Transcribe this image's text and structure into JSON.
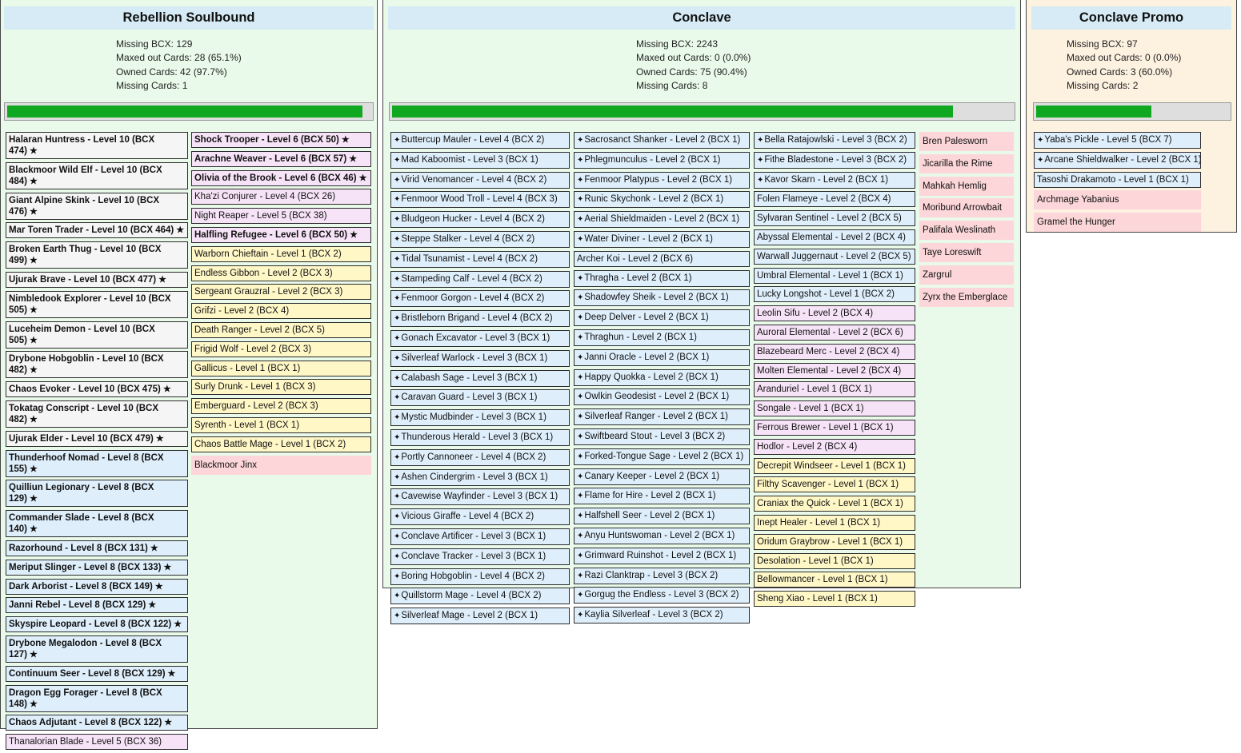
{
  "colors": {
    "panel_green": "#eafaea",
    "panel_orange": "#fdf1e0",
    "title_blue": "#d6ebf5",
    "progress_green": "#0fa820",
    "card_gray": "#f5f5f5",
    "card_blue": "#deeefb",
    "card_yellow": "#fff7c6",
    "card_pink": "#f7e3f7",
    "card_red": "#fcd6d8"
  },
  "panels": [
    {
      "title": "Rebellion Soulbound",
      "stats": [
        "Missing BCX: 129",
        "Maxed out Cards: 28 (65.1%)",
        "Owned Cards: 42 (97.7%)",
        "Missing Cards: 1"
      ],
      "progress": 0.977,
      "columns": [
        [
          {
            "label": "Halaran Huntress - Level 10 (BCX 474)",
            "style": "gray",
            "bold": true,
            "star": true
          },
          {
            "label": "Blackmoor Wild Elf - Level 10 (BCX 484)",
            "style": "gray",
            "bold": true,
            "star": true
          },
          {
            "label": "Giant Alpine Skink - Level 10 (BCX 476)",
            "style": "gray",
            "bold": true,
            "star": true
          },
          {
            "label": "Mar Toren Trader - Level 10 (BCX 464)",
            "style": "gray",
            "bold": true,
            "star": true
          },
          {
            "label": "Broken Earth Thug - Level 10 (BCX 499)",
            "style": "gray",
            "bold": true,
            "star": true
          },
          {
            "label": "Ujurak Brave - Level 10 (BCX 477)",
            "style": "gray",
            "bold": true,
            "star": true
          },
          {
            "label": "Nimbledook Explorer - Level 10 (BCX 505)",
            "style": "gray",
            "bold": true,
            "star": true
          },
          {
            "label": "Luceheim Demon - Level 10 (BCX 505)",
            "style": "gray",
            "bold": true,
            "star": true
          },
          {
            "label": "Drybone Hobgoblin - Level 10 (BCX 482)",
            "style": "gray",
            "bold": true,
            "star": true
          },
          {
            "label": "Chaos Evoker - Level 10 (BCX 475)",
            "style": "gray",
            "bold": true,
            "star": true
          },
          {
            "label": "Tokatag Conscript - Level 10 (BCX 482)",
            "style": "gray",
            "bold": true,
            "star": true
          },
          {
            "label": "Ujurak Elder - Level 10 (BCX 479)",
            "style": "gray",
            "bold": true,
            "star": true
          },
          {
            "label": "Thunderhoof Nomad - Level 8 (BCX 155)",
            "style": "blue",
            "bold": true,
            "star": true
          },
          {
            "label": "Quilliun Legionary - Level 8 (BCX 129)",
            "style": "blue",
            "bold": true,
            "star": true
          },
          {
            "label": "Commander Slade - Level 8 (BCX 140)",
            "style": "blue",
            "bold": true,
            "star": true
          },
          {
            "label": "Razorhound - Level 8 (BCX 131)",
            "style": "blue",
            "bold": true,
            "star": true
          },
          {
            "label": "Meriput Slinger - Level 8 (BCX 133)",
            "style": "blue",
            "bold": true,
            "star": true
          },
          {
            "label": "Dark Arborist - Level 8 (BCX 149)",
            "style": "blue",
            "bold": true,
            "star": true
          },
          {
            "label": "Janni Rebel - Level 8 (BCX 129)",
            "style": "blue",
            "bold": true,
            "star": true
          },
          {
            "label": "Skyspire Leopard - Level 8 (BCX 122)",
            "style": "blue",
            "bold": true,
            "star": true
          },
          {
            "label": "Drybone Megalodon - Level 8 (BCX 127)",
            "style": "blue",
            "bold": true,
            "star": true
          },
          {
            "label": "Continuum Seer - Level 8 (BCX 129)",
            "style": "blue",
            "bold": true,
            "star": true
          },
          {
            "label": "Dragon Egg Forager - Level 8 (BCX 148)",
            "style": "blue",
            "bold": true,
            "star": true
          },
          {
            "label": "Chaos Adjutant - Level 8 (BCX 122)",
            "style": "blue",
            "bold": true,
            "star": true
          },
          {
            "label": "Thanalorian Blade - Level 5 (BCX 36)",
            "style": "pink"
          }
        ],
        [
          {
            "label": "Shock Trooper - Level 6 (BCX 50)",
            "style": "pink",
            "bold": true,
            "star": true
          },
          {
            "label": "Arachne Weaver - Level 6 (BCX 57)",
            "style": "pink",
            "bold": true,
            "star": true
          },
          {
            "label": "Olivia of the Brook - Level 6 (BCX 46)",
            "style": "pink",
            "bold": true,
            "star": true
          },
          {
            "label": "Kha'zi Conjurer - Level 4 (BCX 26)",
            "style": "pink"
          },
          {
            "label": "Night Reaper - Level 5 (BCX 38)",
            "style": "pink"
          },
          {
            "label": "Halfling Refugee - Level 6 (BCX 50)",
            "style": "pink",
            "bold": true,
            "star": true
          },
          {
            "label": "Warborn Chieftain - Level 1 (BCX 2)",
            "style": "yellow"
          },
          {
            "label": "Endless Gibbon - Level 2 (BCX 3)",
            "style": "yellow"
          },
          {
            "label": "Sergeant Grauzral - Level 2 (BCX 3)",
            "style": "yellow"
          },
          {
            "label": "Grifzi - Level 2 (BCX 4)",
            "style": "yellow"
          },
          {
            "label": "Death Ranger - Level 2 (BCX 5)",
            "style": "yellow"
          },
          {
            "label": "Frigid Wolf - Level 2 (BCX 3)",
            "style": "yellow"
          },
          {
            "label": "Gallicus - Level 1 (BCX 1)",
            "style": "yellow"
          },
          {
            "label": "Surly Drunk - Level 1 (BCX 3)",
            "style": "yellow"
          },
          {
            "label": "Emberguard - Level 2 (BCX 3)",
            "style": "yellow"
          },
          {
            "label": "Syrenth - Level 1 (BCX 1)",
            "style": "yellow"
          },
          {
            "label": "Chaos Battle Mage - Level 1 (BCX 2)",
            "style": "yellow"
          },
          {
            "label": "Blackmoor Jinx",
            "style": "red"
          }
        ]
      ]
    },
    {
      "title": "Conclave",
      "stats": [
        "Missing BCX: 2243",
        "Maxed out Cards: 0 (0.0%)",
        "Owned Cards: 75 (90.4%)",
        "Missing Cards: 8"
      ],
      "progress": 0.904,
      "columns": [
        [
          {
            "label": "Buttercup Mauler - Level 4 (BCX 2)",
            "style": "blue",
            "bolt": true
          },
          {
            "label": "Mad Kaboomist - Level 3 (BCX 1)",
            "style": "blue",
            "bolt": true
          },
          {
            "label": "Virid Venomancer - Level 4 (BCX 2)",
            "style": "blue",
            "bolt": true
          },
          {
            "label": "Fenmoor Wood Troll - Level 4 (BCX 3)",
            "style": "blue",
            "bolt": true
          },
          {
            "label": "Bludgeon Hucker - Level 4 (BCX 2)",
            "style": "blue",
            "bolt": true
          },
          {
            "label": "Steppe Stalker - Level 4 (BCX 2)",
            "style": "blue",
            "bolt": true
          },
          {
            "label": "Tidal Tsunamist - Level 4 (BCX 2)",
            "style": "blue",
            "bolt": true
          },
          {
            "label": "Stampeding Calf - Level 4 (BCX 2)",
            "style": "blue",
            "bolt": true
          },
          {
            "label": "Fenmoor Gorgon - Level 4 (BCX 2)",
            "style": "blue",
            "bolt": true
          },
          {
            "label": "Bristleborn Brigand - Level 4 (BCX 2)",
            "style": "blue",
            "bolt": true
          },
          {
            "label": "Gonach Excavator - Level 3 (BCX 1)",
            "style": "blue",
            "bolt": true
          },
          {
            "label": "Silverleaf Warlock - Level 3 (BCX 1)",
            "style": "blue",
            "bolt": true
          },
          {
            "label": "Calabash Sage - Level 3 (BCX 1)",
            "style": "blue",
            "bolt": true
          },
          {
            "label": "Caravan Guard - Level 3 (BCX 1)",
            "style": "blue",
            "bolt": true
          },
          {
            "label": "Mystic Mudbinder - Level 3 (BCX 1)",
            "style": "blue",
            "bolt": true
          },
          {
            "label": "Thunderous Herald - Level 3 (BCX 1)",
            "style": "blue",
            "bolt": true
          },
          {
            "label": "Portly Cannoneer - Level 4 (BCX 2)",
            "style": "blue",
            "bolt": true
          },
          {
            "label": "Ashen Cindergrim - Level 3 (BCX 1)",
            "style": "blue",
            "bolt": true
          },
          {
            "label": "Cavewise Wayfinder - Level 3 (BCX 1)",
            "style": "blue",
            "bolt": true
          },
          {
            "label": "Vicious Giraffe - Level 4 (BCX 2)",
            "style": "blue",
            "bolt": true
          },
          {
            "label": "Conclave Artificer - Level 3 (BCX 1)",
            "style": "blue",
            "bolt": true
          },
          {
            "label": "Conclave Tracker - Level 3 (BCX 1)",
            "style": "blue",
            "bolt": true
          },
          {
            "label": "Boring Hobgoblin - Level 4 (BCX 2)",
            "style": "blue",
            "bolt": true
          },
          {
            "label": "Quillstorm Mage - Level 4 (BCX 2)",
            "style": "blue",
            "bolt": true
          },
          {
            "label": "Silverleaf Mage - Level 2 (BCX 1)",
            "style": "blue",
            "bolt": true
          }
        ],
        [
          {
            "label": "Sacrosanct Shanker - Level 2 (BCX 1)",
            "style": "blue",
            "bolt": true
          },
          {
            "label": "Phlegmunculus - Level 2 (BCX 1)",
            "style": "blue",
            "bolt": true
          },
          {
            "label": "Fenmoor Platypus - Level 2 (BCX 1)",
            "style": "blue",
            "bolt": true
          },
          {
            "label": "Runic Skychonk - Level 2 (BCX 1)",
            "style": "blue",
            "bolt": true
          },
          {
            "label": "Aerial Shieldmaiden - Level 2 (BCX 1)",
            "style": "blue",
            "bolt": true
          },
          {
            "label": "Water Diviner - Level 2 (BCX 1)",
            "style": "blue",
            "bolt": true
          },
          {
            "label": "Archer Koi - Level 2 (BCX 6)",
            "style": "blue"
          },
          {
            "label": "Thragha - Level 2 (BCX 1)",
            "style": "blue",
            "bolt": true
          },
          {
            "label": "Shadowfey Sheik - Level 2 (BCX 1)",
            "style": "blue",
            "bolt": true
          },
          {
            "label": "Deep Delver - Level 2 (BCX 1)",
            "style": "blue",
            "bolt": true
          },
          {
            "label": "Thraghun - Level 2 (BCX 1)",
            "style": "blue",
            "bolt": true
          },
          {
            "label": "Janni Oracle - Level 2 (BCX 1)",
            "style": "blue",
            "bolt": true
          },
          {
            "label": "Happy Quokka - Level 2 (BCX 1)",
            "style": "blue",
            "bolt": true
          },
          {
            "label": "Owlkin Geodesist - Level 2 (BCX 1)",
            "style": "blue",
            "bolt": true
          },
          {
            "label": "Silverleaf Ranger - Level 2 (BCX 1)",
            "style": "blue",
            "bolt": true
          },
          {
            "label": "Swiftbeard Stout - Level 3 (BCX 2)",
            "style": "blue",
            "bolt": true
          },
          {
            "label": "Forked-Tongue Sage - Level 2 (BCX 1)",
            "style": "blue",
            "bolt": true
          },
          {
            "label": "Canary Keeper - Level 2 (BCX 1)",
            "style": "blue",
            "bolt": true
          },
          {
            "label": "Flame for Hire - Level 2 (BCX 1)",
            "style": "blue",
            "bolt": true
          },
          {
            "label": "Halfshell Seer - Level 2 (BCX 1)",
            "style": "blue",
            "bolt": true
          },
          {
            "label": "Anyu Huntswoman - Level 2 (BCX 1)",
            "style": "blue",
            "bolt": true
          },
          {
            "label": "Grimward Ruinshot - Level 2 (BCX 1)",
            "style": "blue",
            "bolt": true
          },
          {
            "label": "Razi Clanktrap - Level 3 (BCX 2)",
            "style": "blue",
            "bolt": true
          },
          {
            "label": "Gorgug the Endless - Level 3 (BCX 2)",
            "style": "blue",
            "bolt": true
          },
          {
            "label": "Kaylia Silverleaf - Level 3 (BCX 2)",
            "style": "blue",
            "bolt": true
          }
        ],
        [
          {
            "label": "Bella Ratajowlski - Level 3 (BCX 2)",
            "style": "blue",
            "bolt": true
          },
          {
            "label": "Fithe Bladestone - Level 3 (BCX 2)",
            "style": "blue",
            "bolt": true
          },
          {
            "label": "Kavor Skarn - Level 2 (BCX 1)",
            "style": "blue",
            "bolt": true
          },
          {
            "label": "Folen Flameye - Level 2 (BCX 4)",
            "style": "blue"
          },
          {
            "label": "Sylvaran Sentinel - Level 2 (BCX 5)",
            "style": "blue"
          },
          {
            "label": "Abyssal Elemental - Level 2 (BCX 4)",
            "style": "blue"
          },
          {
            "label": "Warwall Juggernaut - Level 2 (BCX 5)",
            "style": "blue"
          },
          {
            "label": "Umbral Elemental - Level 1 (BCX 1)",
            "style": "blue"
          },
          {
            "label": "Lucky Longshot - Level 1 (BCX 2)",
            "style": "blue"
          },
          {
            "label": "Leolin Sifu - Level 2 (BCX 4)",
            "style": "pink"
          },
          {
            "label": "Auroral Elemental - Level 2 (BCX 6)",
            "style": "pink"
          },
          {
            "label": "Blazebeard Merc - Level 2 (BCX 4)",
            "style": "pink"
          },
          {
            "label": "Molten Elemental - Level 2 (BCX 4)",
            "style": "pink"
          },
          {
            "label": "Aranduriel - Level 1 (BCX 1)",
            "style": "pink"
          },
          {
            "label": "Songale - Level 1 (BCX 1)",
            "style": "pink"
          },
          {
            "label": "Ferrous Brewer - Level 1 (BCX 1)",
            "style": "pink"
          },
          {
            "label": "Hodlor - Level 2 (BCX 4)",
            "style": "pink"
          },
          {
            "label": "Decrepit Windseer - Level 1 (BCX 1)",
            "style": "yellow"
          },
          {
            "label": "Filthy Scavenger - Level 1 (BCX 1)",
            "style": "yellow"
          },
          {
            "label": "Craniax the Quick - Level 1 (BCX 1)",
            "style": "yellow"
          },
          {
            "label": "Inept Healer - Level 1 (BCX 1)",
            "style": "yellow"
          },
          {
            "label": "Oridum Graybrow - Level 1 (BCX 1)",
            "style": "yellow"
          },
          {
            "label": "Desolation - Level 1 (BCX 1)",
            "style": "yellow"
          },
          {
            "label": "Bellowmancer - Level 1 (BCX 1)",
            "style": "yellow"
          },
          {
            "label": "Sheng Xiao - Level 1 (BCX 1)",
            "style": "yellow"
          }
        ],
        [
          {
            "label": "Bren Palesworn",
            "style": "red"
          },
          {
            "label": "Jicarilla the Rime",
            "style": "red"
          },
          {
            "label": "Mahkah Hemlig",
            "style": "red"
          },
          {
            "label": "Moribund Arrowbait",
            "style": "red"
          },
          {
            "label": "Palifala Weslinath",
            "style": "red"
          },
          {
            "label": "Taye Loreswift",
            "style": "red"
          },
          {
            "label": "Zargrul",
            "style": "red"
          },
          {
            "label": "Zyrx the Emberglace",
            "style": "red"
          }
        ]
      ]
    },
    {
      "title": "Conclave Promo",
      "stats": [
        "Missing BCX: 97",
        "Maxed out Cards: 0 (0.0%)",
        "Owned Cards: 3 (60.0%)",
        "Missing Cards: 2"
      ],
      "progress": 0.6,
      "columns": [
        [
          {
            "label": "Yaba's Pickle - Level 5 (BCX 7)",
            "style": "blue",
            "bolt": true
          },
          {
            "label": "Arcane Shieldwalker - Level 2 (BCX 1)",
            "style": "blue",
            "bolt": true
          },
          {
            "label": "Tasoshi Drakamoto - Level 1 (BCX 1)",
            "style": "blue"
          },
          {
            "label": "Archmage Yabanius",
            "style": "red"
          },
          {
            "label": "Gramel the Hunger",
            "style": "red"
          }
        ]
      ]
    }
  ]
}
